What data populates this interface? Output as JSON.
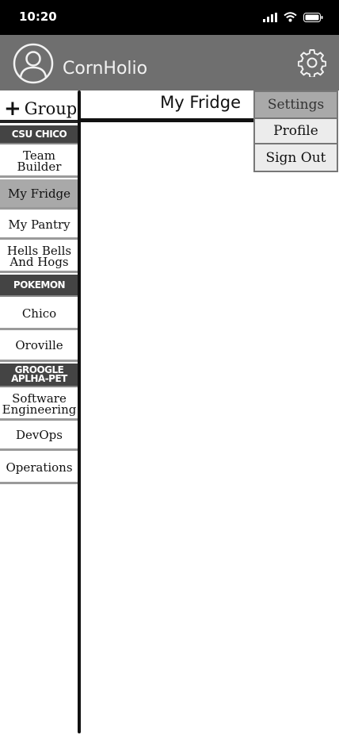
{
  "status_bar": {
    "time": "10:20",
    "icons": [
      "signal-icon",
      "wifi-icon",
      "battery-icon"
    ]
  },
  "header": {
    "avatar_icon": "user-avatar-icon",
    "user_name": "CornHolio",
    "settings_icon": "gear-icon"
  },
  "sidebar": {
    "add_group_symbol": "+",
    "add_group_label": "Group",
    "sections": [
      {
        "title": "CSU CHICO",
        "items": [
          {
            "label": "Team Builder",
            "active": false
          },
          {
            "label": "My Fridge",
            "active": true
          },
          {
            "label": "My Pantry",
            "active": false
          },
          {
            "label": "Hells Bells And Hogs",
            "active": false
          }
        ]
      },
      {
        "title": "POKEMON",
        "items": [
          {
            "label": "Chico",
            "active": false
          },
          {
            "label": "Oroville",
            "active": false
          }
        ]
      },
      {
        "title": "GROOGLE APLHA-PET",
        "items": [
          {
            "label": "Software Engineering",
            "active": false
          },
          {
            "label": "DevOps",
            "active": false
          },
          {
            "label": "Operations",
            "active": false
          }
        ]
      }
    ]
  },
  "main": {
    "title": "My Fridge"
  },
  "settings_menu": {
    "header": "Settings",
    "items": [
      "Profile",
      "Sign Out"
    ]
  },
  "colors": {
    "header_bg": "#6f6f6f",
    "section_bg": "#444444",
    "active_item_bg": "#a9a9a9",
    "menu_bg": "#ececec"
  }
}
